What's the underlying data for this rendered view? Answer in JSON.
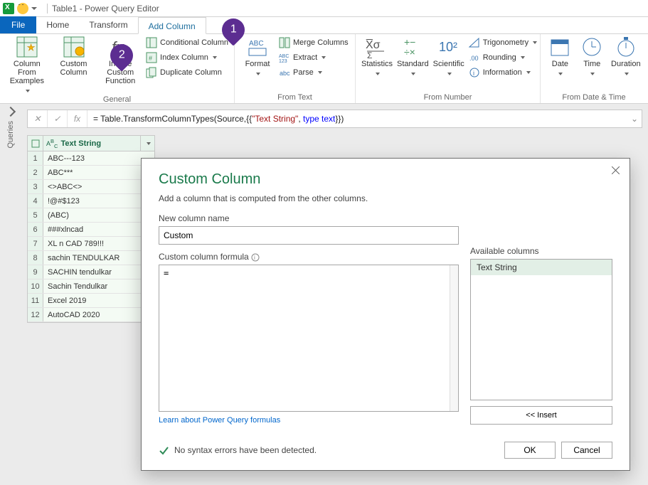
{
  "window": {
    "title": "Table1 - Power Query Editor"
  },
  "tabs": {
    "file": "File",
    "home": "Home",
    "transform": "Transform",
    "addcolumn": "Add Column"
  },
  "ribbon": {
    "general": {
      "col_from_examples": "Column From Examples",
      "custom_column": "Custom Column",
      "invoke_fn": "Invoke Custom Function",
      "cond_col": "Conditional Column",
      "index_col": "Index Column",
      "dup_col": "Duplicate Column",
      "label": "General"
    },
    "fromtext": {
      "format": "Format",
      "merge": "Merge Columns",
      "extract": "Extract",
      "parse": "Parse",
      "label": "From Text"
    },
    "fromnumber": {
      "stats": "Statistics",
      "standard": "Standard",
      "scientific": "Scientific",
      "trig": "Trigonometry",
      "rounding": "Rounding",
      "info": "Information",
      "label": "From Number"
    },
    "fromdatetime": {
      "date": "Date",
      "time": "Time",
      "duration": "Duration",
      "label": "From Date & Time"
    }
  },
  "queries_pane": "Queries",
  "formula_bar": {
    "prefix": "= Table.TransformColumnTypes(Source,{{",
    "str": "\"Text String\"",
    "sep": ", ",
    "kw1": "type",
    "kw2": "text",
    "suffix": "}})"
  },
  "grid": {
    "column": "Text String",
    "rows": [
      "ABC---123",
      "ABC***",
      "<>ABC<>",
      "!@#$123",
      "(ABC)",
      "###xlncad",
      "XL n CAD 789!!!",
      "sachin TENDULKAR",
      "SACHIN tendulkar",
      "Sachin Tendulkar",
      "Excel 2019",
      "AutoCAD 2020"
    ]
  },
  "dialog": {
    "title": "Custom Column",
    "subtitle": "Add a column that is computed from the other columns.",
    "newname_label": "New column name",
    "newname_value": "Custom",
    "formula_label": "Custom column formula",
    "formula_value": "=",
    "avail_label": "Available columns",
    "avail_item": "Text String",
    "insert": "<< Insert",
    "learn": "Learn about Power Query formulas",
    "syntax_msg": "No syntax errors have been detected.",
    "ok": "OK",
    "cancel": "Cancel"
  },
  "callouts": {
    "one": "1",
    "two": "2"
  }
}
